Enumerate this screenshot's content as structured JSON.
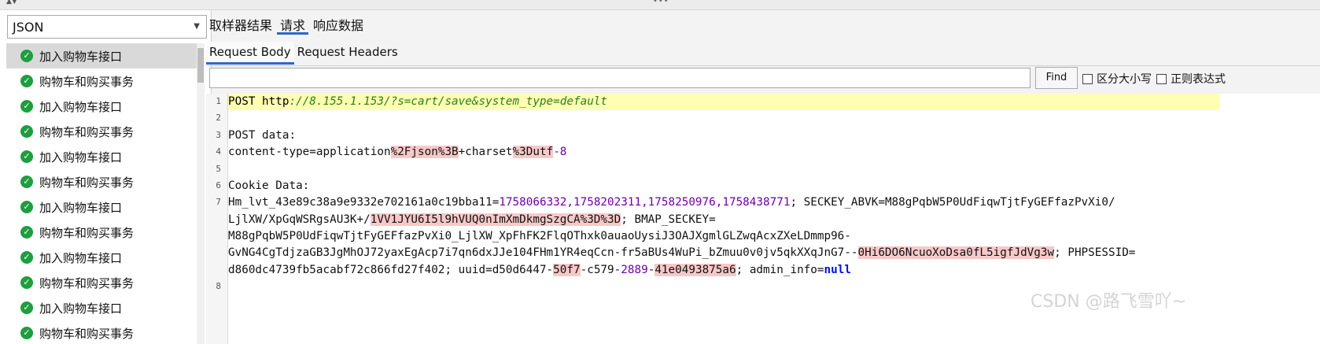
{
  "format_select": {
    "value": "JSON"
  },
  "tree_items": [
    "加入购物车接口",
    "购物车和购买事务",
    "加入购物车接口",
    "购物车和购买事务",
    "加入购物车接口",
    "购物车和购买事务",
    "加入购物车接口",
    "购物车和购买事务",
    "加入购物车接口",
    "购物车和购买事务",
    "加入购物车接口",
    "购物车和购买事务"
  ],
  "top_tabs": [
    "取样器结果",
    "请求",
    "响应数据"
  ],
  "sub_tabs": [
    "Request Body",
    "Request Headers"
  ],
  "search": {
    "placeholder": "",
    "find_label": "Find",
    "case_label": "区分大小写",
    "regex_label": "正则表达式"
  },
  "line_numbers": [
    "1",
    "2",
    "3",
    "4",
    "5",
    "6",
    "7",
    "8"
  ],
  "code": {
    "l1_method": "POST http",
    "l1_url": "://8.155.1.153/?s=cart/save&system_type=default",
    "l3": "POST data:",
    "l4_a": "content-type=application",
    "l4_b": "%2Fjson%3B",
    "l4_c": "+charset",
    "l4_d": "%3Dutf",
    "l4_e": "-8",
    "l6": "Cookie Data:",
    "l7a_a": "Hm_lvt_43e89c38a9e9332e702161a0c19bba11=",
    "l7a_nums": "1758066332,1758202311,1758250976,1758438771",
    "l7a_b": "; SECKEY_ABVK=M88gPqbW5P0UdFiqwTjtFyGEFfazPvXi0/",
    "l7b_a": "LjlXW/XpGqWSRgsAU3K+/",
    "l7b_b": "1VV1JYU6I5l9hVUQ0nImXmDkmgSzgCA%3D%3D",
    "l7b_c": "; BMAP_SECKEY=",
    "l7c": "M88gPqbW5P0UdFiqwTjtFyGEFfazPvXi0_LjlXW_XpFhFK2FlqOThxk0auaoUysiJ3OAJXgmlGLZwqAcxZXeLDmmp96-",
    "l7d_a": "GvNG4CgTdjzaGB3JgMhOJ72yaxEgAcp7i7qn6dxJJe104FHm1YR4eqCcn-fr5aBUs4WuPi_bZmuu0v0jv5qkXXqJnG7--",
    "l7d_b": "0Hi6DO6NcuoXoDsa0fL5igfJdVg3w",
    "l7d_c": "; PHPSESSID=",
    "l7e_a": "d860dc4739fb5acabf72c866fd27f402; uuid=d50d6447-",
    "l7e_b": "50f7",
    "l7e_c": "-c579-",
    "l7e_d": "2889",
    "l7e_e": "-",
    "l7e_f": "41e0493875a6",
    "l7e_g": "; admin_info=",
    "l7e_null": "null"
  },
  "watermark": "CSDN @路飞雪吖~"
}
